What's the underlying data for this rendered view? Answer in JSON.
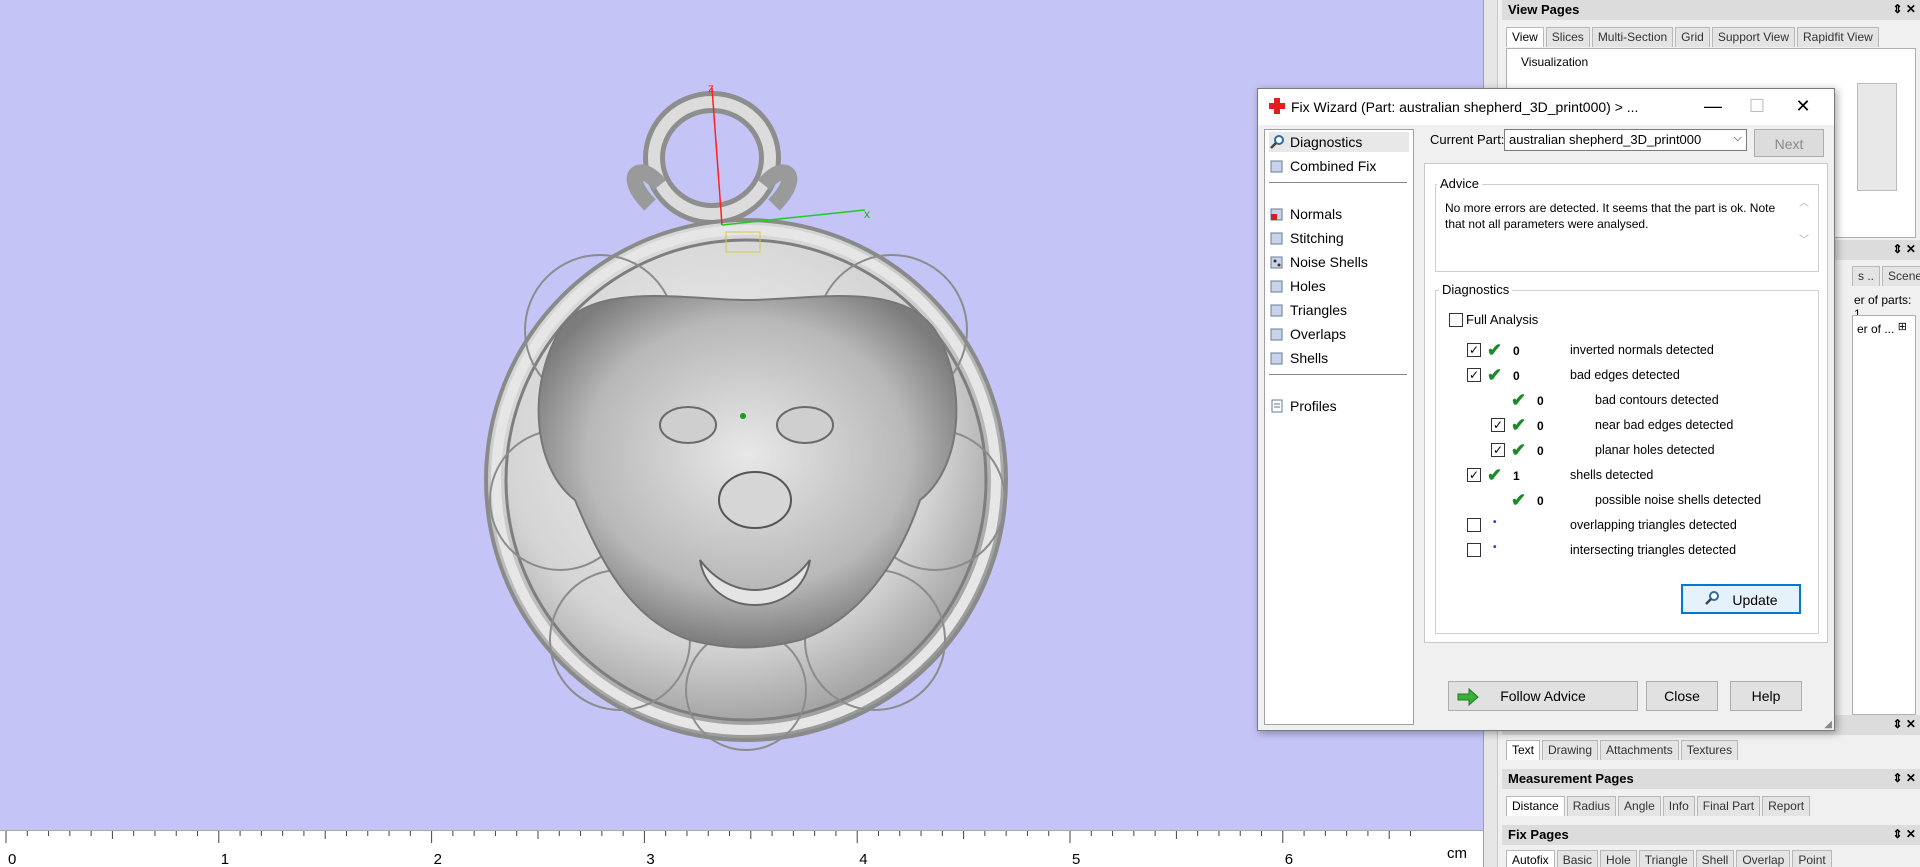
{
  "ruler": {
    "ticks": [
      "0",
      "1",
      "2",
      "3",
      "4",
      "5",
      "6"
    ],
    "unit": "cm"
  },
  "axes": {
    "x": "x",
    "z": "z"
  },
  "right_panels": {
    "view_pages": {
      "title": "View Pages",
      "tabs": [
        "View",
        "Slices",
        "Multi-Section",
        "Grid",
        "Support View",
        "Rapidfit View"
      ],
      "group_label": "Visualization"
    },
    "parts_panel": {
      "tabs": [
        "s ..",
        "Scenes"
      ],
      "line1": "er of parts: 1",
      "line2": "er of ..."
    },
    "drawing_panel": {
      "tabs": [
        "Text",
        "Drawing",
        "Attachments",
        "Textures"
      ]
    },
    "measurement_pages": {
      "title": "Measurement Pages",
      "tabs": [
        "Distance",
        "Radius",
        "Angle",
        "Info",
        "Final Part",
        "Report"
      ]
    },
    "fix_pages": {
      "title": "Fix Pages",
      "tabs": [
        "Autofix",
        "Basic",
        "Hole",
        "Triangle",
        "Shell",
        "Overlap",
        "Point"
      ]
    }
  },
  "dialog": {
    "title": "Fix Wizard (Part: australian shepherd_3D_print000) > ...",
    "nav": {
      "top": [
        "Diagnostics",
        "Combined Fix"
      ],
      "tools": [
        "Normals",
        "Stitching",
        "Noise Shells",
        "Holes",
        "Triangles",
        "Overlaps",
        "Shells"
      ],
      "bottom": [
        "Profiles"
      ]
    },
    "current_part_label": "Current Part:",
    "current_part_value": "australian shepherd_3D_print000",
    "next_label": "Next",
    "advice_label": "Advice",
    "advice_text": "No more errors are detected. It seems that the part is ok. Note that not all parameters were analysed.",
    "diagnostics_label": "Diagnostics",
    "full_analysis_label": "Full Analysis",
    "rows": [
      {
        "checkbox": true,
        "status": "ok",
        "count": "0",
        "text": "inverted normals detected",
        "indent": 0
      },
      {
        "checkbox": true,
        "status": "ok",
        "count": "0",
        "text": "bad edges detected",
        "indent": 0
      },
      {
        "checkbox": false,
        "status": "ok",
        "count": "0",
        "text": "bad contours detected",
        "indent": 1,
        "hide_box": true
      },
      {
        "checkbox": true,
        "status": "ok",
        "count": "0",
        "text": "near bad edges detected",
        "indent": 1
      },
      {
        "checkbox": true,
        "status": "ok",
        "count": "0",
        "text": "planar holes detected",
        "indent": 1
      },
      {
        "checkbox": true,
        "status": "ok",
        "count": "1",
        "text": "shells detected",
        "indent": 0
      },
      {
        "checkbox": false,
        "status": "ok",
        "count": "0",
        "text": "possible noise shells detected",
        "indent": 1,
        "hide_box": true
      },
      {
        "checkbox": false,
        "status": "pending",
        "count": "",
        "text": "overlapping triangles detected",
        "indent": 0
      },
      {
        "checkbox": false,
        "status": "pending",
        "count": "",
        "text": "intersecting triangles detected",
        "indent": 0
      }
    ],
    "update_label": "Update",
    "follow_advice_label": "Follow Advice",
    "close_label": "Close",
    "help_label": "Help"
  }
}
